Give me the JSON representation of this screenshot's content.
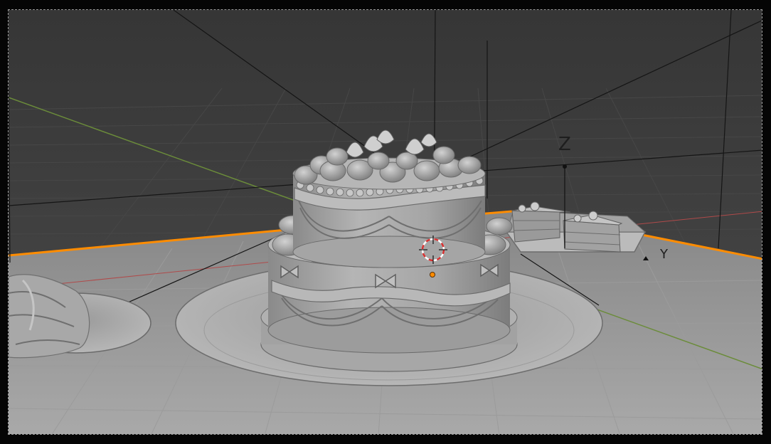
{
  "app": {
    "name": "3D viewport",
    "mode": "camera-view"
  },
  "viewport": {
    "shading": "solid",
    "scene": {
      "objects": [
        "two-tier-cake",
        "cake-plate",
        "cake-slice",
        "slice-plate",
        "bundt-cake",
        "bundt-plate",
        "floor-plane"
      ]
    },
    "axes": {
      "z_label": "Z",
      "y_label": "Y"
    },
    "overlays": {
      "camera_frame": "dashed-border",
      "origin_marker": "orange-dot",
      "cursor_3d": "red-white-ring"
    }
  },
  "colors": {
    "background": "#3d3d3d",
    "grid": "#484848",
    "floor": "#8c8c8c",
    "floor_edge": "#ff8c00",
    "x_axis": "#b04a4a",
    "y_axis": "#6b8c3a",
    "light_lines": "#111111",
    "mesh": "#9e9e9e"
  }
}
